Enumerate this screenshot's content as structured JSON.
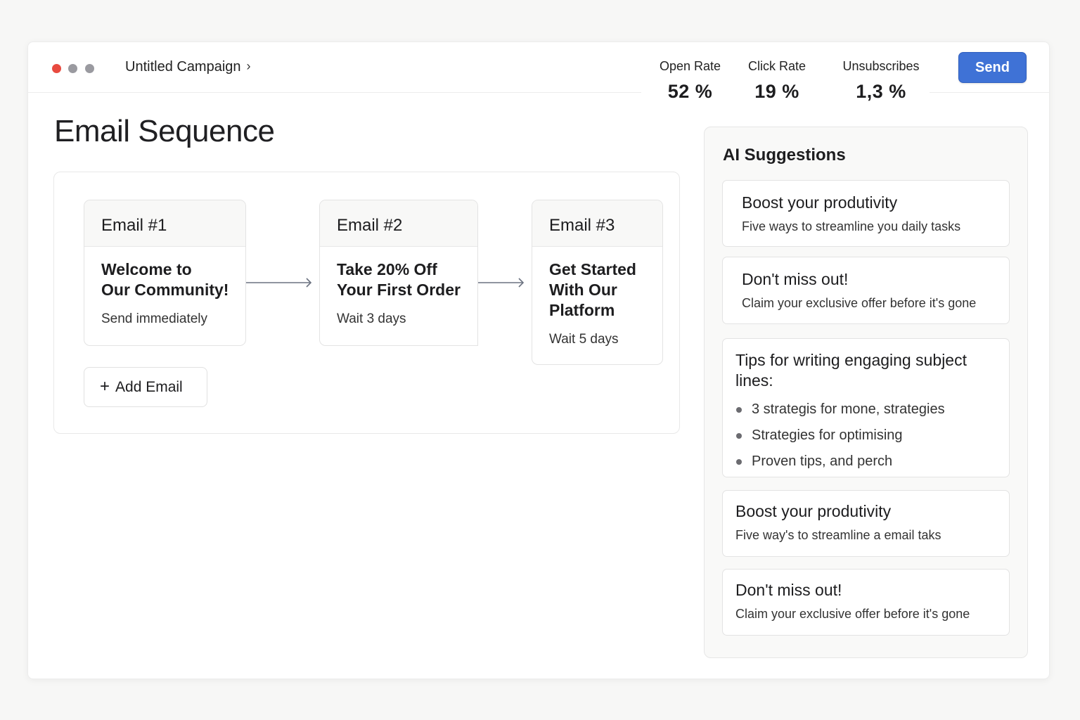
{
  "window": {
    "breadcrumb": "Untitled Campaign",
    "breadcrumb_chevron": "›"
  },
  "stats": [
    {
      "label": "Open Rate",
      "value": "52 %"
    },
    {
      "label": "Click Rate",
      "value": "19 %"
    },
    {
      "label": "Unsubscribes",
      "value": "1,3 %"
    }
  ],
  "send_label": "Send",
  "page_title": "Email Sequence",
  "emails": [
    {
      "name": "Email #1",
      "subject": "Welcome to Our Community!",
      "timing": "Send immediately"
    },
    {
      "name": "Email #2",
      "subject": "Take 20% Off Your First Order",
      "timing": "Wait 3 days"
    },
    {
      "name": "Email #3",
      "subject": "Get Started With Our Platform",
      "timing": "Wait 5 days"
    }
  ],
  "add_email": {
    "icon": "+",
    "label": "Add Email"
  },
  "ai": {
    "title": "AI Suggestions",
    "suggestions": [
      {
        "title": "Boost your produtivity",
        "desc": "Five ways to streamline you daily tasks"
      },
      {
        "title": "Don't miss out!",
        "desc": "Claim your exclusive offer before it's gone"
      },
      {
        "title": "Tips for writing engaging subject lines:",
        "bullets": [
          "3 strategis for mone, strategies",
          "Strategies for optimising",
          "Proven  tips, and perch"
        ]
      },
      {
        "title": "Boost your produtivity",
        "desc": "Five way's to streamline a email taks"
      },
      {
        "title": "Don't miss out!",
        "desc": "Claim your exclusive offer before it's gone"
      }
    ]
  },
  "colors": {
    "accent": "#3f72d6",
    "close_dot": "#e84a3f",
    "inactive_dot": "#9a9aa0"
  }
}
